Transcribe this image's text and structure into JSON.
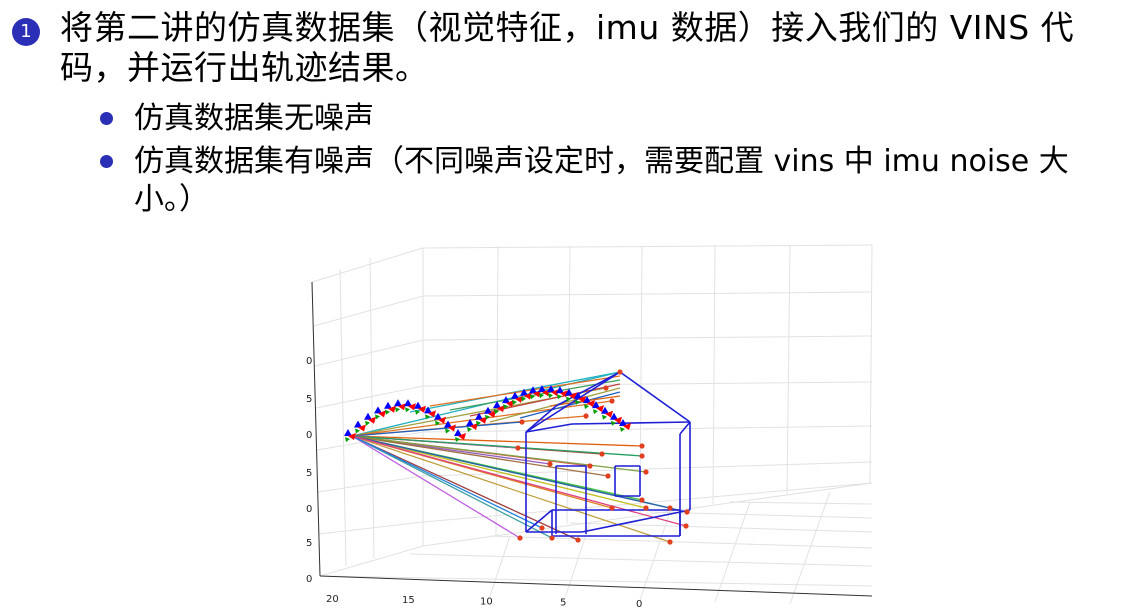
{
  "item": {
    "number": "1",
    "text": "将第二讲的仿真数据集（视觉特征，imu 数据）接入我们的 VINS 代码，并运行出轨迹结果。"
  },
  "bullets": [
    "仿真数据集无噪声",
    "仿真数据集有噪声（不同噪声设定时，需要配置 vins 中 imu noise 大小。）"
  ],
  "figure": {
    "x_ticks": [
      "20",
      "15",
      "10",
      "5",
      "0",
      "",
      ""
    ],
    "z_ticks": [
      "0",
      "5",
      "0",
      "5",
      "0",
      "5",
      "0"
    ],
    "colors": {
      "house": "#1f1fd6",
      "accent": "#2b2fb5",
      "landmark": "#e04020",
      "pose_x": "#ff0000",
      "pose_y": "#00a000",
      "pose_z": "#0000ff"
    }
  }
}
